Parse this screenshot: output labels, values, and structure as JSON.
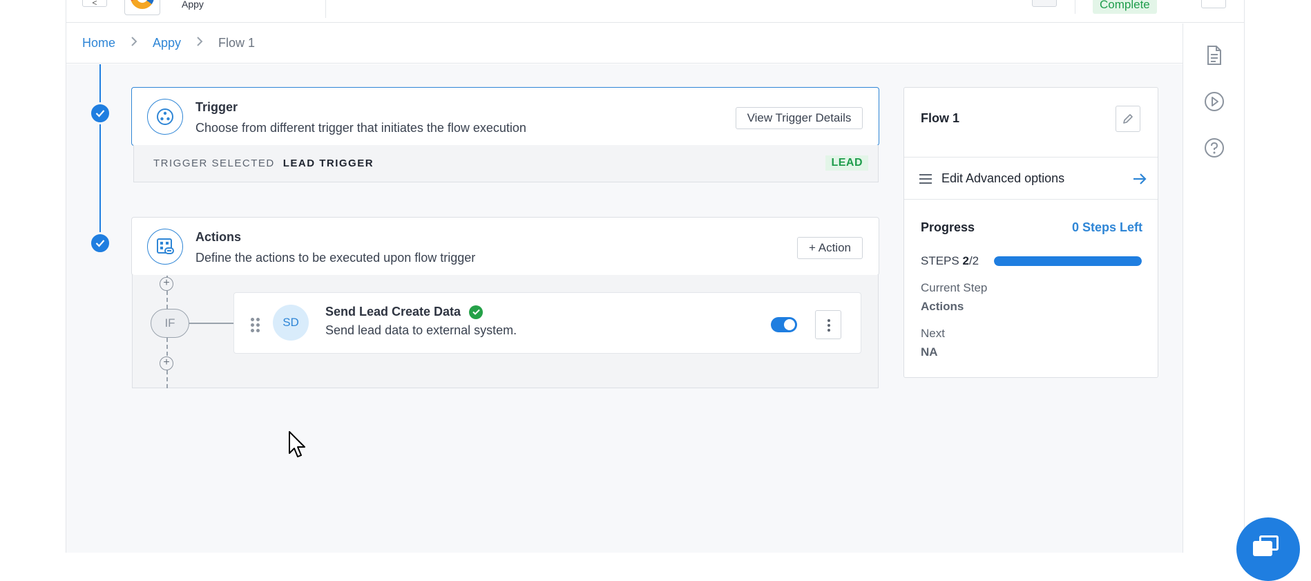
{
  "header": {
    "back_label": "<",
    "app_name": "Appy",
    "status": "Complete"
  },
  "breadcrumb": {
    "items": [
      "Home",
      "Appy"
    ],
    "current": "Flow 1",
    "separator": ">"
  },
  "trigger": {
    "title": "Trigger",
    "description": "Choose from different trigger that initiates the flow execution",
    "button": "View Trigger Details",
    "selected_label": "TRIGGER SELECTED",
    "selected_value": "LEAD TRIGGER",
    "badge": "LEAD"
  },
  "actions": {
    "title": "Actions",
    "description": "Define the actions to be executed upon flow trigger",
    "button": "+ Action",
    "condition_label": "IF",
    "item": {
      "avatar": "SD",
      "title": "Send Lead Create Data",
      "description": "Send lead data to external system.",
      "enabled": true
    }
  },
  "summary": {
    "flow_name": "Flow 1",
    "advanced_label": "Edit Advanced options",
    "progress_title": "Progress",
    "steps_left": "0 Steps Left",
    "steps_prefix": "STEPS",
    "steps_done": "2",
    "steps_total": "/2",
    "progress_fraction": 1.0,
    "current_step_label": "Current Step",
    "current_step_value": "Actions",
    "next_label": "Next",
    "next_value": "NA"
  },
  "rail": {
    "icons": [
      "document-icon",
      "play-icon",
      "help-icon"
    ]
  },
  "colors": {
    "accent": "#1f7ee0",
    "link": "#2f86d6",
    "success": "#1f9d4c",
    "success_bg": "#e3f5e8"
  }
}
